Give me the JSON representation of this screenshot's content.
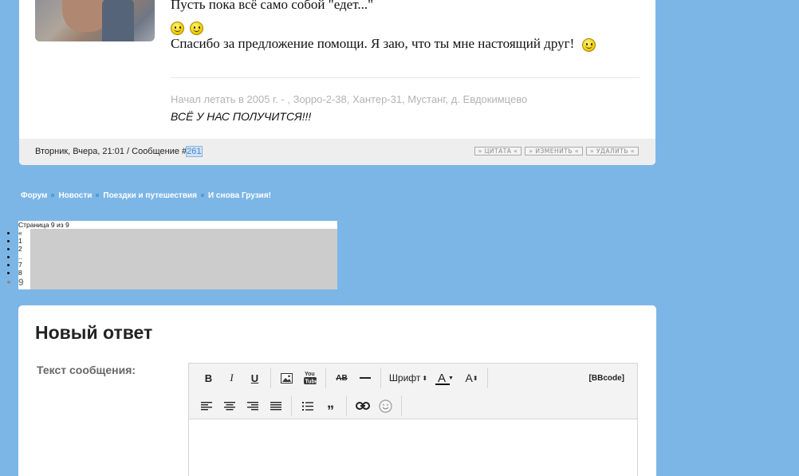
{
  "post": {
    "line1": "Пусть пока всё само собой \"едет...\"",
    "line3": "Спасибо за предложение помощи. Я заю, что ты мне настоящий друг!",
    "signature_line1": "Начал летать в 2005 г. - , Зорро-2-38, Хантер-31, Мустанг, д. Евдокимцево",
    "signature_line2": "ВСЁ У НАС ПОЛУЧИТСЯ!!!",
    "meta_prefix": "Вторник, Вчера, 21:01 / Сообщение #",
    "post_number": "261",
    "actions": {
      "quote": "ЦИТАТА",
      "edit": "ИЗМЕНИТЬ",
      "delete": "УДАЛИТЬ"
    }
  },
  "breadcrumbs": [
    "Форум",
    "Новости",
    "Поездки и путешествия",
    "И снова Грузия!"
  ],
  "pagination": {
    "title": "Страница 9 из 9",
    "items": [
      "«",
      "1",
      "2",
      "..",
      "7",
      "8"
    ],
    "current": "9"
  },
  "reply": {
    "title": "Новый ответ",
    "message_label": "Текст сообщения:",
    "toolbar": {
      "bold": "B",
      "italic": "I",
      "underline": "U",
      "youtube": "You Tube",
      "strike": "AB",
      "font": "Шрифт",
      "color": "A",
      "size": "A",
      "bbcode": "[BBcode]",
      "quote": "„"
    }
  },
  "icons": {
    "smiley": "smiley-icon",
    "image": "image-icon",
    "link": "link-icon"
  },
  "colors": {
    "background": "#7cb6e6",
    "card": "#ffffff",
    "footer": "#eeeeee",
    "signature": "#b3b3b3"
  }
}
